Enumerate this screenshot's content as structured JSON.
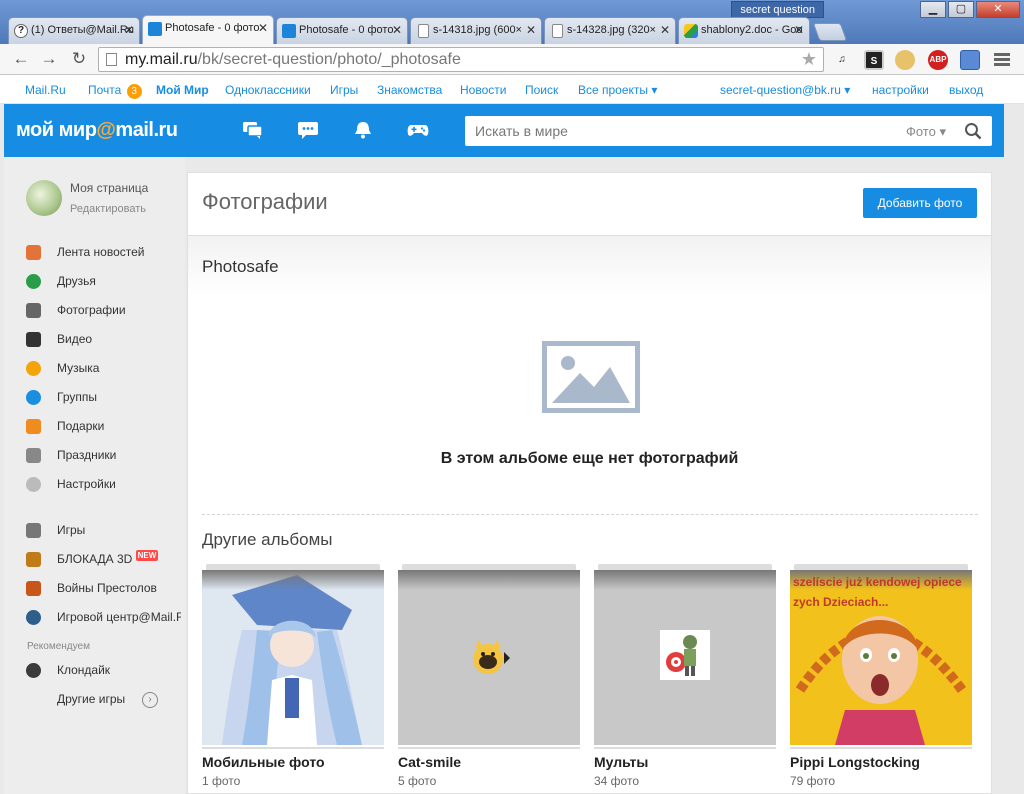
{
  "window": {
    "user_tag": "secret question",
    "controls": {
      "minimize": "▁",
      "maximize": "▢",
      "close": "✕"
    }
  },
  "tabs": [
    {
      "title": "(1) Ответы@Mail.Ru",
      "favicon": "question-icon"
    },
    {
      "title": "Photosafe - 0 фото",
      "favicon": "mail-ru-icon",
      "active": true
    },
    {
      "title": "Photosafe - 0 фото",
      "favicon": "mail-ru-icon"
    },
    {
      "title": "s-14318.jpg (600×",
      "favicon": "document-icon"
    },
    {
      "title": "s-14328.jpg (320×",
      "favicon": "document-icon"
    },
    {
      "title": "shablony2.doc - Goo",
      "favicon": "drive-icon"
    }
  ],
  "toolbar": {
    "back": "←",
    "forward": "→",
    "reload": "↻",
    "url_host": "my.mail.ru",
    "url_path": "/bk/secret-question/photo/_photosafe",
    "star": "★"
  },
  "portal": {
    "mailru": "Mail.Ru",
    "pochta": "Почта",
    "pochta_count": "3",
    "moimir": "Мой Мир",
    "ok": "Одноклассники",
    "igry": "Игры",
    "znakomstva": "Знакомства",
    "novosti": "Новости",
    "poisk": "Поиск",
    "vse": "Все проекты ▾",
    "email": "secret-question@bk.ru ▾",
    "settings": "настройки",
    "logout": "выход"
  },
  "header": {
    "logo_left": "мой мир",
    "logo_at": "@",
    "logo_right": "mail.ru",
    "search_placeholder": "Искать в мире",
    "search_scope": "Фото ▾"
  },
  "sidebar": {
    "my_page": "Моя страница",
    "edit": "Редактировать",
    "items": [
      {
        "label": "Лента новостей",
        "icon": "home-icon",
        "color": "#e4733a"
      },
      {
        "label": "Друзья",
        "icon": "friends-icon",
        "color": "#2a9d4a"
      },
      {
        "label": "Фотографии",
        "icon": "camera-icon",
        "color": "#666666"
      },
      {
        "label": "Видео",
        "icon": "clapper-icon",
        "color": "#333333"
      },
      {
        "label": "Музыка",
        "icon": "music-note-icon",
        "color": "#f4a30b"
      },
      {
        "label": "Группы",
        "icon": "groups-icon",
        "color": "#1a8fe0"
      },
      {
        "label": "Подарки",
        "icon": "gift-icon",
        "color": "#f08b1f"
      },
      {
        "label": "Праздники",
        "icon": "calendar-icon",
        "color": "#888888"
      },
      {
        "label": "Настройки",
        "icon": "gear-icon",
        "color": "#bbbbbb"
      }
    ],
    "games": [
      {
        "label": "Игры",
        "icon": "gamepad-icon",
        "color": "#777777"
      },
      {
        "label": "БЛОКАДА 3D",
        "icon": "blockade-icon",
        "color": "#c07a18",
        "badge": "NEW"
      },
      {
        "label": "Войны Престолов",
        "icon": "thrones-icon",
        "color": "#c8561a"
      },
      {
        "label": "Игровой центр@Mail.Ru",
        "icon": "game-center-icon",
        "color": "#2d5f8a"
      }
    ],
    "recommended": "Рекомендуем",
    "klondike": {
      "label": "Клондайк",
      "icon": "klondike-icon",
      "color": "#3b3b3b"
    },
    "other_games": "Другие игры"
  },
  "main": {
    "title": "Фотографии",
    "add_button": "Добавить фото",
    "album_title": "Photosafe",
    "empty_text": "В этом альбоме еще нет фотографий",
    "other_albums": "Другие альбомы",
    "albums": [
      {
        "name": "Мобильные фото",
        "count": "1 фото"
      },
      {
        "name": "Cat-smile",
        "count": "5 фото"
      },
      {
        "name": "Мульты",
        "count": "34 фото"
      },
      {
        "name": "Pippi Longstocking",
        "count": "79 фото",
        "caption": "szelíscie już kendowej opiece zych Dzieciach..."
      }
    ]
  },
  "colors": {
    "brand_blue": "#168de2",
    "accent_orange": "#ffa930",
    "badge_orange": "#ff9e00"
  }
}
